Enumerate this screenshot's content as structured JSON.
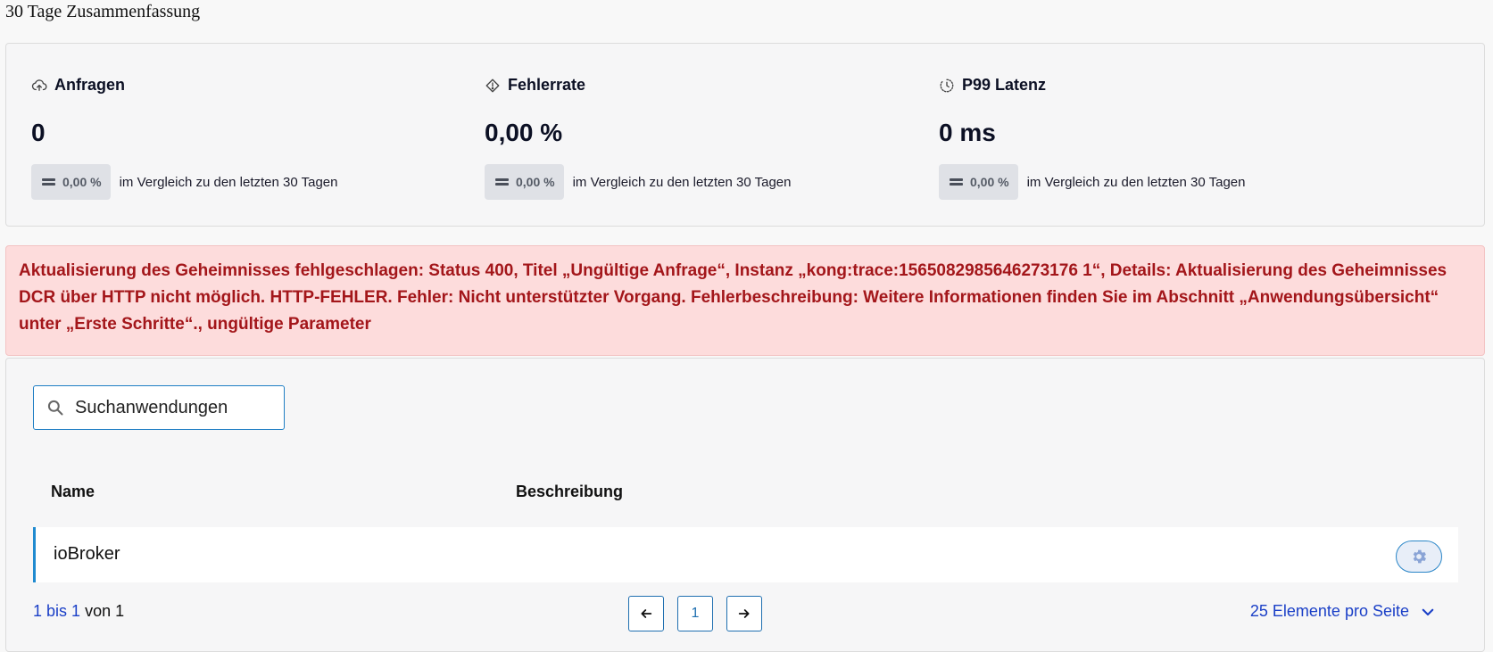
{
  "page": {
    "title": "30 Tage Zusammenfassung"
  },
  "metrics": [
    {
      "label": "Anfragen",
      "icon": "cloud-upload-icon",
      "value": "0",
      "delta": "0,00 %",
      "compare": "im Vergleich zu den letzten 30 Tagen"
    },
    {
      "label": "Fehlerrate",
      "icon": "warning-diamond-icon",
      "value": "0,00 %",
      "delta": "0,00 %",
      "compare": "im Vergleich zu den letzten 30 Tagen"
    },
    {
      "label": "P99 Latenz",
      "icon": "timer-icon",
      "value": "0 ms",
      "delta": "0,00 %",
      "compare": "im Vergleich zu den letzten 30 Tagen"
    }
  ],
  "alert": {
    "message": "Aktualisierung des Geheimnisses fehlgeschlagen: Status 400, Titel „Ungültige Anfrage“, Instanz „kong:trace:1565082985646273176 1“, Details: Aktualisierung des Geheimnisses DCR über HTTP nicht möglich. HTTP-FEHLER. Fehler: Nicht unterstützter Vorgang. Fehlerbeschreibung: Weitere Informationen finden Sie im Abschnitt „Anwendungsübersicht“ unter „Erste Schritte“., ungültige Parameter",
    "color": "#a3161a",
    "background": "#fddcdc"
  },
  "search": {
    "placeholder": "Suchanwendungen",
    "value": ""
  },
  "table": {
    "columns": [
      "Name",
      "Beschreibung"
    ],
    "rows": [
      {
        "name": "ioBroker",
        "description": ""
      }
    ]
  },
  "pagination": {
    "range": "1 bis 1",
    "of_label": "von 1",
    "current_page": "1",
    "prev_icon": "arrow-left-icon",
    "next_icon": "arrow-right-icon",
    "per_page": "25 Elemente pro Seite"
  },
  "colors": {
    "accent": "#1f7ec4",
    "link": "#1a3fc7"
  }
}
